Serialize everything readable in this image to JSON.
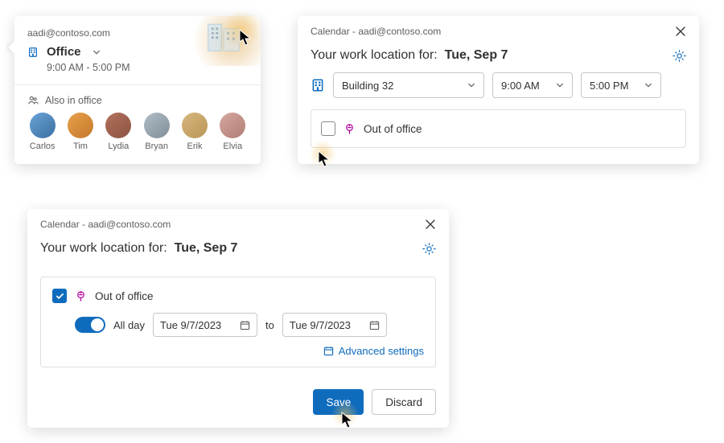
{
  "account": "aadi@contoso.com",
  "card1": {
    "location_label": "Office",
    "hours": "9:00 AM - 5:00 PM",
    "also_label": "Also in office",
    "people": [
      {
        "name": "Carlos"
      },
      {
        "name": "Tim"
      },
      {
        "name": "Lydia"
      },
      {
        "name": "Bryan"
      },
      {
        "name": "Erik"
      },
      {
        "name": "Elvia"
      }
    ]
  },
  "card2": {
    "window_title": "Calendar - aadi@contoso.com",
    "heading_prefix": "Your work location for:",
    "heading_date": "Tue, Sep 7",
    "building": "Building 32",
    "start_time": "9:00 AM",
    "end_time": "5:00 PM",
    "ooo_label": "Out of office"
  },
  "card3": {
    "window_title": "Calendar - aadi@contoso.com",
    "heading_prefix": "Your work location for:",
    "heading_date": "Tue, Sep 7",
    "ooo_label": "Out of office",
    "all_day_label": "All day",
    "date_start": "Tue 9/7/2023",
    "to_label": "to",
    "date_end": "Tue 9/7/2023",
    "advanced_label": "Advanced settings",
    "save_label": "Save",
    "discard_label": "Discard"
  }
}
